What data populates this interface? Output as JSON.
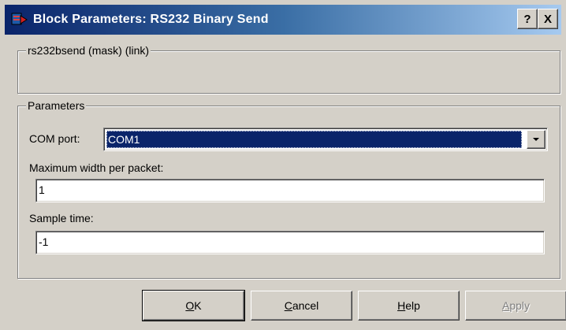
{
  "window": {
    "title": "Block Parameters: RS232 Binary Send",
    "help_label": "?",
    "close_label": "X"
  },
  "mask_group": {
    "title": "rs232bsend (mask) (link)"
  },
  "params_group": {
    "title": "Parameters",
    "com_port": {
      "label": "COM port:",
      "value": "COM1"
    },
    "max_width": {
      "label": "Maximum width per packet:",
      "value": "1"
    },
    "sample_time": {
      "label": "Sample time:",
      "value": "-1"
    }
  },
  "buttons": {
    "ok": {
      "first": "O",
      "rest": "K"
    },
    "cancel": {
      "first": "C",
      "rest": "ancel"
    },
    "help": {
      "first": "H",
      "rest": "elp"
    },
    "apply": {
      "first": "A",
      "rest": "pply"
    }
  },
  "icons": {
    "app": "simulink-block-icon",
    "dropdown": "chevron-down-icon"
  },
  "colors": {
    "titlebar_start": "#0a246a",
    "titlebar_end": "#a6caf0",
    "selection": "#0a246a",
    "face": "#d4d0c8"
  }
}
